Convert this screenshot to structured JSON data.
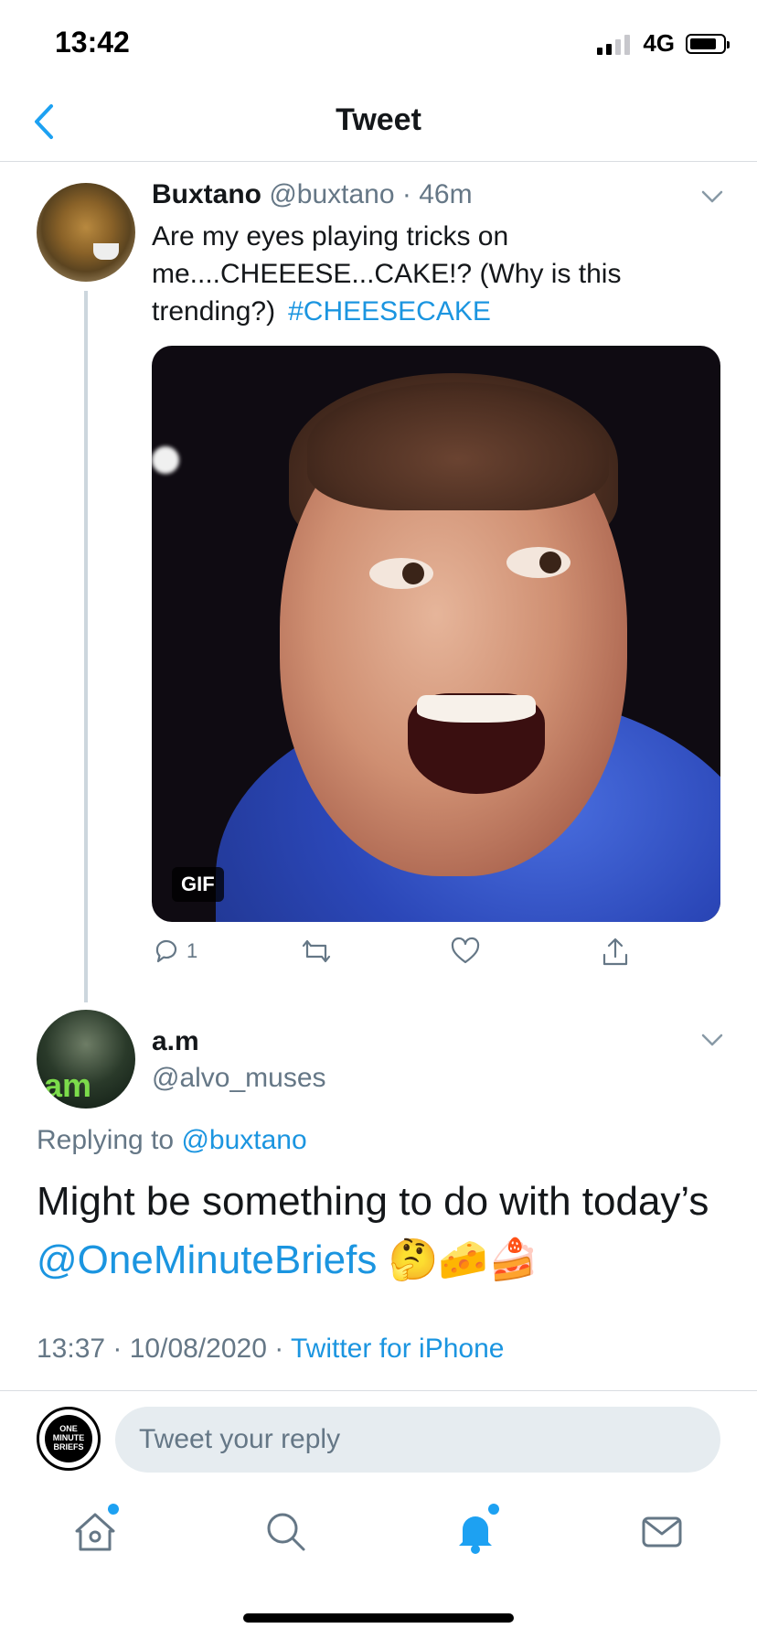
{
  "status_bar": {
    "time": "13:42",
    "network": "4G",
    "signal_bars_filled": 2,
    "battery_level": 0.75
  },
  "nav": {
    "title": "Tweet",
    "back_icon": "chevron-left-icon"
  },
  "tweet": {
    "name": "Buxtano",
    "handle": "@buxtano",
    "separator": "·",
    "time": "46m",
    "text": "Are my eyes playing tricks on me....CHEEESE...CAKE!? (Why is this trending?)",
    "hashtag": "#CHEESECAKE",
    "media_badge": "GIF",
    "actions": {
      "reply_count": "1"
    }
  },
  "reply": {
    "name": "a.m",
    "handle": "@alvo_muses",
    "avatar_text": "am",
    "replying_prefix": "Replying to",
    "replying_to": "@buxtano",
    "text": "Might be something to do with today’s",
    "mention": "@OneMinuteBriefs",
    "emojis": "🤔🧀🍰",
    "timestamp": "13:37 · 10/08/2020 ·",
    "source": "Twitter for iPhone"
  },
  "composer": {
    "placeholder": "Tweet your reply",
    "avatar_text": "ONE MINUTE BRIEFS"
  },
  "tab_bar": {
    "items": [
      "home-icon",
      "search-icon",
      "notifications-icon",
      "messages-icon"
    ],
    "accent": "#1da1f2"
  },
  "colors": {
    "link": "#1b95e0",
    "secondary": "#657786",
    "primary_text": "#14171a"
  }
}
